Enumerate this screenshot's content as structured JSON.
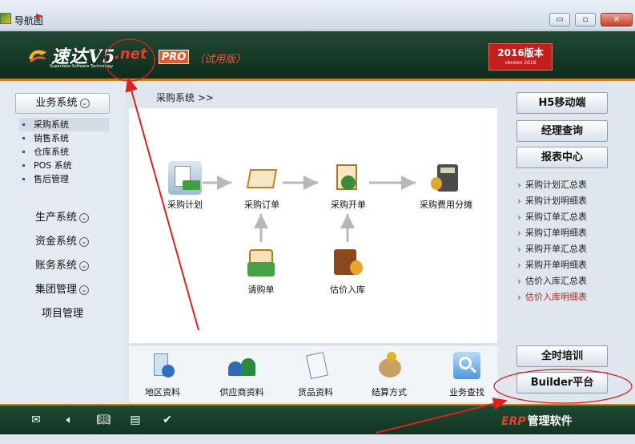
{
  "window": {
    "title": "导航图",
    "controls": [
      "▭",
      "▫",
      "✕"
    ]
  },
  "header": {
    "brand": "速达V5",
    "brand_suffix": ".net",
    "brand_sub": "Superdata Software Technology",
    "pro": "PRO",
    "trial": "（试用版）",
    "version": "2016版本",
    "version_sub": "Version 2016"
  },
  "left_nav": {
    "business": "业务系统",
    "sub_items": [
      "采购系统",
      "销售系统",
      "仓库系统",
      "POS 系统",
      "售后管理"
    ],
    "production": "生产系统",
    "finance": "资金系统",
    "accounting": "账务系统",
    "group": "集团管理",
    "project": "项目管理"
  },
  "breadcrumb": "采购系统 >>",
  "flow": {
    "plan": "采购计划",
    "order": "采购订单",
    "invoice": "采购开单",
    "cost": "采购费用分摊",
    "request": "请购单",
    "estimate": "估价入库"
  },
  "bottom_strip": {
    "region": "地区资料",
    "supplier": "供应商资料",
    "goods": "货品资料",
    "settlement": "结算方式",
    "search": "业务查找"
  },
  "right": {
    "mobile": "H5移动端",
    "manager": "经理查询",
    "report": "报表中心",
    "reports": [
      "采购计划汇总表",
      "采购计划明细表",
      "采购订单汇总表",
      "采购订单明细表",
      "采购开单汇总表",
      "采购开单明细表",
      "估价入库汇总表",
      "估价入库明细表"
    ],
    "training": "全时培训",
    "builder": "Builder平台"
  },
  "footer": {
    "erp": "ERP",
    "label": "管理软件"
  },
  "colors": {
    "header_green": "#163826",
    "accent_orange": "#c7801c",
    "annotation_red": "#e02020",
    "highlight_red": "#b3261e"
  }
}
